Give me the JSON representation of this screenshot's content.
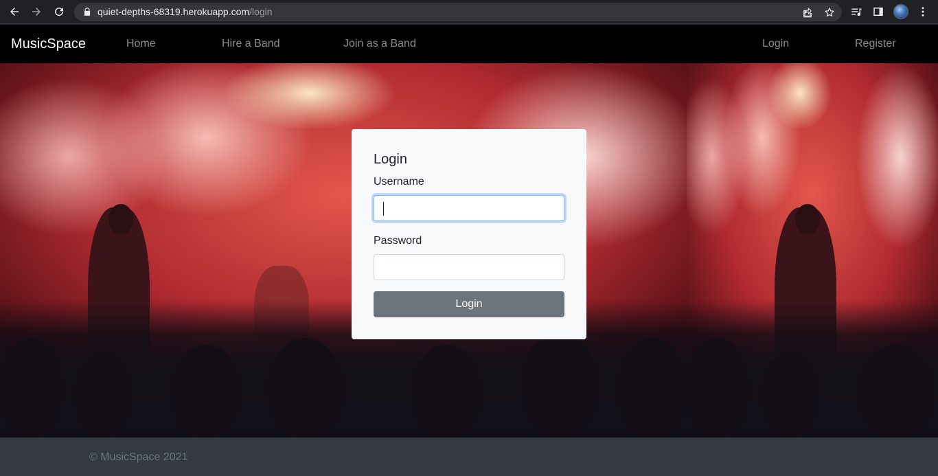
{
  "browser": {
    "url_host": "quiet-depths-68319.herokuapp.com",
    "url_path": "/login"
  },
  "navbar": {
    "brand": "MusicSpace",
    "links": [
      {
        "label": "Home"
      },
      {
        "label": "Hire a Band"
      },
      {
        "label": "Join as a Band"
      },
      {
        "label": "Login"
      },
      {
        "label": "Register"
      }
    ]
  },
  "login_card": {
    "title": "Login",
    "username_label": "Username",
    "username_value": "",
    "password_label": "Password",
    "password_value": "",
    "submit_label": "Login"
  },
  "footer": {
    "text": "© MusicSpace 2021"
  },
  "colors": {
    "navbar_bg": "#000000",
    "footer_bg": "#343a40",
    "card_bg": "#f8f9fa",
    "button_bg": "#6c757d"
  }
}
